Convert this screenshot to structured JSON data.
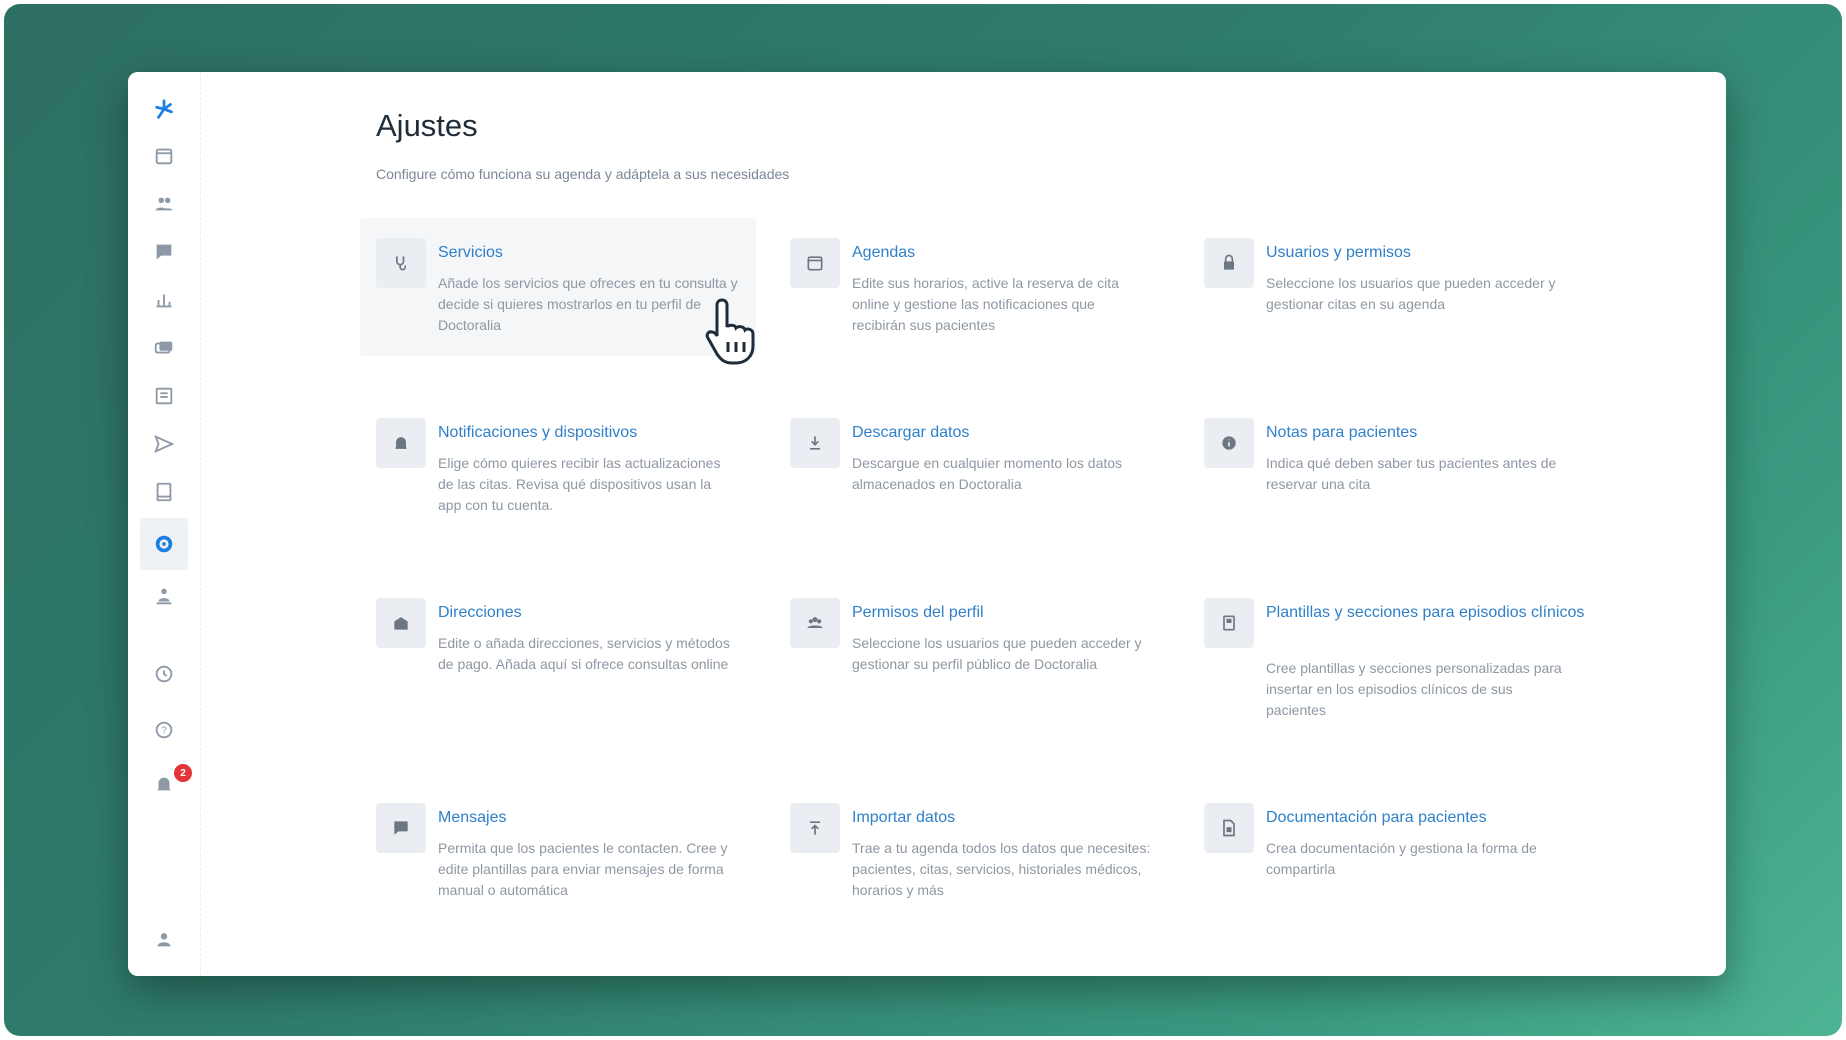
{
  "page": {
    "title": "Ajustes",
    "subtitle": "Configure cómo funciona su agenda y adáptela a sus necesidades"
  },
  "sidebar": {
    "items": [
      {
        "icon": "logo-icon"
      },
      {
        "icon": "calendar-icon"
      },
      {
        "icon": "patients-icon"
      },
      {
        "icon": "messages-icon"
      },
      {
        "icon": "stats-icon"
      },
      {
        "icon": "payments-icon"
      },
      {
        "icon": "documents-icon"
      },
      {
        "icon": "send-icon"
      },
      {
        "icon": "records-icon"
      },
      {
        "icon": "settings-icon",
        "active": true
      },
      {
        "icon": "profile-icon"
      },
      {
        "icon": "updates-icon"
      },
      {
        "icon": "help-icon"
      },
      {
        "icon": "notifications-icon",
        "badge": "2"
      },
      {
        "icon": "account-icon"
      }
    ]
  },
  "cards": [
    {
      "title": "Servicios",
      "desc": "Añade los servicios que ofreces en tu consulta y decide si quieres mostrarlos en tu perfil de Doctoralia",
      "icon": "services-icon"
    },
    {
      "title": "Agendas",
      "desc": "Edite sus horarios, active la reserva de cita online y gestione las notificaciones que recibirán sus pacientes",
      "icon": "calendar-icon"
    },
    {
      "title": "Usuarios y permisos",
      "desc": "Seleccione los usuarios que pueden acceder y gestionar citas en su agenda",
      "icon": "lock-icon"
    },
    {
      "title": "Notificaciones y dispositivos",
      "desc": "Elige cómo quieres recibir las actualizaciones de las citas. Revisa qué dispositivos usan la app con tu cuenta.",
      "icon": "bell-icon"
    },
    {
      "title": "Descargar datos",
      "desc": "Descargue en cualquier momento los datos almacenados en Doctoralia",
      "icon": "download-icon"
    },
    {
      "title": "Notas para pacientes",
      "desc": "Indica qué deben saber tus pacientes antes de reservar una cita",
      "icon": "info-icon"
    },
    {
      "title": "Direcciones",
      "desc": "Edite o añada direcciones, servicios y métodos de pago. Añada aquí si ofrece consultas online",
      "icon": "building-icon"
    },
    {
      "title": "Permisos del perfil",
      "desc": "Seleccione los usuarios que pueden acceder y gestionar su perfil público de Doctoralia",
      "icon": "group-icon"
    },
    {
      "title": "Plantillas y secciones para episodios clínicos",
      "desc": "Cree plantillas y secciones personalizadas para insertar en los episodios clínicos de sus pacientes",
      "icon": "template-icon"
    },
    {
      "title": "Mensajes",
      "desc": "Permita que los pacientes le contacten. Cree y edite plantillas para enviar mensajes de forma manual o automática",
      "icon": "chat-icon"
    },
    {
      "title": "Importar datos",
      "desc": "Trae a tu agenda todos los datos que necesites: pacientes, citas, servicios, historiales médicos, horarios y más",
      "icon": "upload-icon"
    },
    {
      "title": "Documentación para pacientes",
      "desc": "Crea documentación y gestiona la forma de compartirla",
      "icon": "file-icon"
    }
  ],
  "colors": {
    "accent": "#2f80c9",
    "backdrop": "#2f7d6c",
    "badge": "#e2353a"
  }
}
